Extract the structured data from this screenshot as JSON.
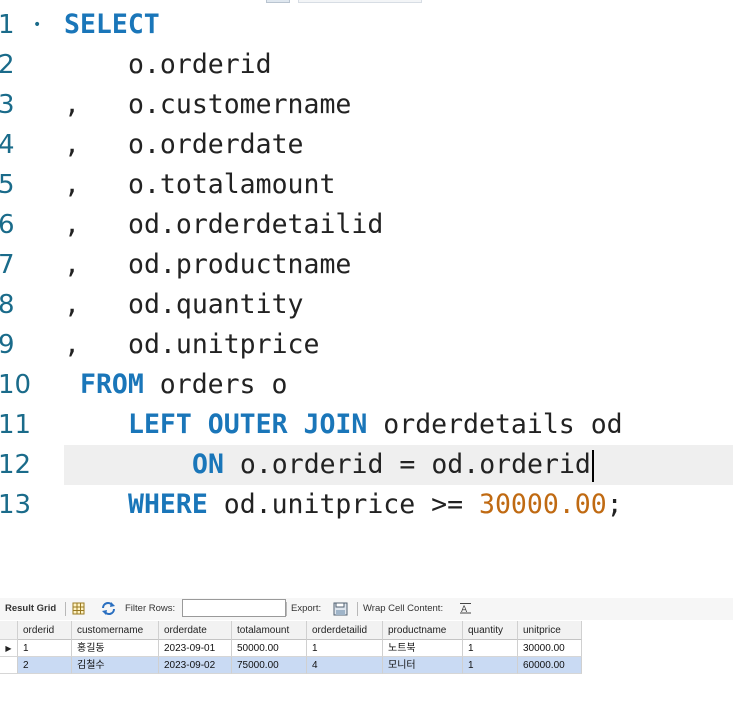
{
  "editor": {
    "lines": [
      {
        "no": "1",
        "tokens": [
          {
            "t": "SELECT",
            "c": "kw"
          }
        ],
        "indent": 64,
        "fold": true
      },
      {
        "no": "2",
        "tokens": [
          {
            "t": "o.orderid",
            "c": ""
          }
        ],
        "indent": 128
      },
      {
        "no": "3",
        "comma": true,
        "tokens": [
          {
            "t": "o.customername",
            "c": ""
          }
        ],
        "indent": 128
      },
      {
        "no": "4",
        "comma": true,
        "tokens": [
          {
            "t": "o.orderdate",
            "c": ""
          }
        ],
        "indent": 128
      },
      {
        "no": "5",
        "comma": true,
        "tokens": [
          {
            "t": "o.totalamount",
            "c": ""
          }
        ],
        "indent": 128
      },
      {
        "no": "6",
        "comma": true,
        "tokens": [
          {
            "t": "od.orderdetailid",
            "c": ""
          }
        ],
        "indent": 128
      },
      {
        "no": "7",
        "comma": true,
        "tokens": [
          {
            "t": "od.productname",
            "c": ""
          }
        ],
        "indent": 128
      },
      {
        "no": "8",
        "comma": true,
        "tokens": [
          {
            "t": "od.quantity",
            "c": ""
          }
        ],
        "indent": 128
      },
      {
        "no": "9",
        "comma": true,
        "tokens": [
          {
            "t": "od.unitprice",
            "c": ""
          }
        ],
        "indent": 128
      },
      {
        "no": "10",
        "tokens": [
          {
            "t": "FROM",
            "c": "kw"
          },
          {
            "t": " orders o",
            "c": ""
          }
        ],
        "indent": 80
      },
      {
        "no": "11",
        "tokens": [
          {
            "t": "LEFT OUTER JOIN",
            "c": "kw"
          },
          {
            "t": " orderdetails od",
            "c": ""
          }
        ],
        "indent": 128
      },
      {
        "no": "12",
        "current": true,
        "caret": true,
        "tokens": [
          {
            "t": "ON",
            "c": "kw"
          },
          {
            "t": " o.orderid = od.orderid",
            "c": ""
          }
        ],
        "indent": 192
      },
      {
        "no": "13",
        "tokens": [
          {
            "t": "WHERE",
            "c": "kw"
          },
          {
            "t": " od.unitprice >= ",
            "c": ""
          },
          {
            "t": "30000.00",
            "c": "num"
          },
          {
            "t": ";",
            "c": ""
          }
        ],
        "indent": 128
      }
    ],
    "comma_char": ","
  },
  "toolbar": {
    "result_grid_label": "Result Grid",
    "filter_rows_label": "Filter Rows:",
    "filter_value": "",
    "export_label": "Export:",
    "wrap_label": "Wrap Cell Content:",
    "icons": [
      "grid-icon",
      "refresh-icon",
      "export-icon",
      "wrap-icon"
    ]
  },
  "result": {
    "columns": [
      "orderid",
      "customername",
      "orderdate",
      "totalamount",
      "orderdetailid",
      "productname",
      "quantity",
      "unitprice"
    ],
    "rows": [
      [
        "1",
        "홍길동",
        "2023-09-01",
        "50000.00",
        "1",
        "노트북",
        "1",
        "30000.00"
      ],
      [
        "2",
        "김철수",
        "2023-09-02",
        "75000.00",
        "4",
        "모니터",
        "1",
        "60000.00"
      ]
    ],
    "selected_row_marker": "▶"
  },
  "colors": {
    "keyword": "#1a76b9",
    "number": "#c06a12",
    "line_number": "#1a6b8a",
    "current_line": "#efefef",
    "selected_row": "#c9daf3"
  }
}
